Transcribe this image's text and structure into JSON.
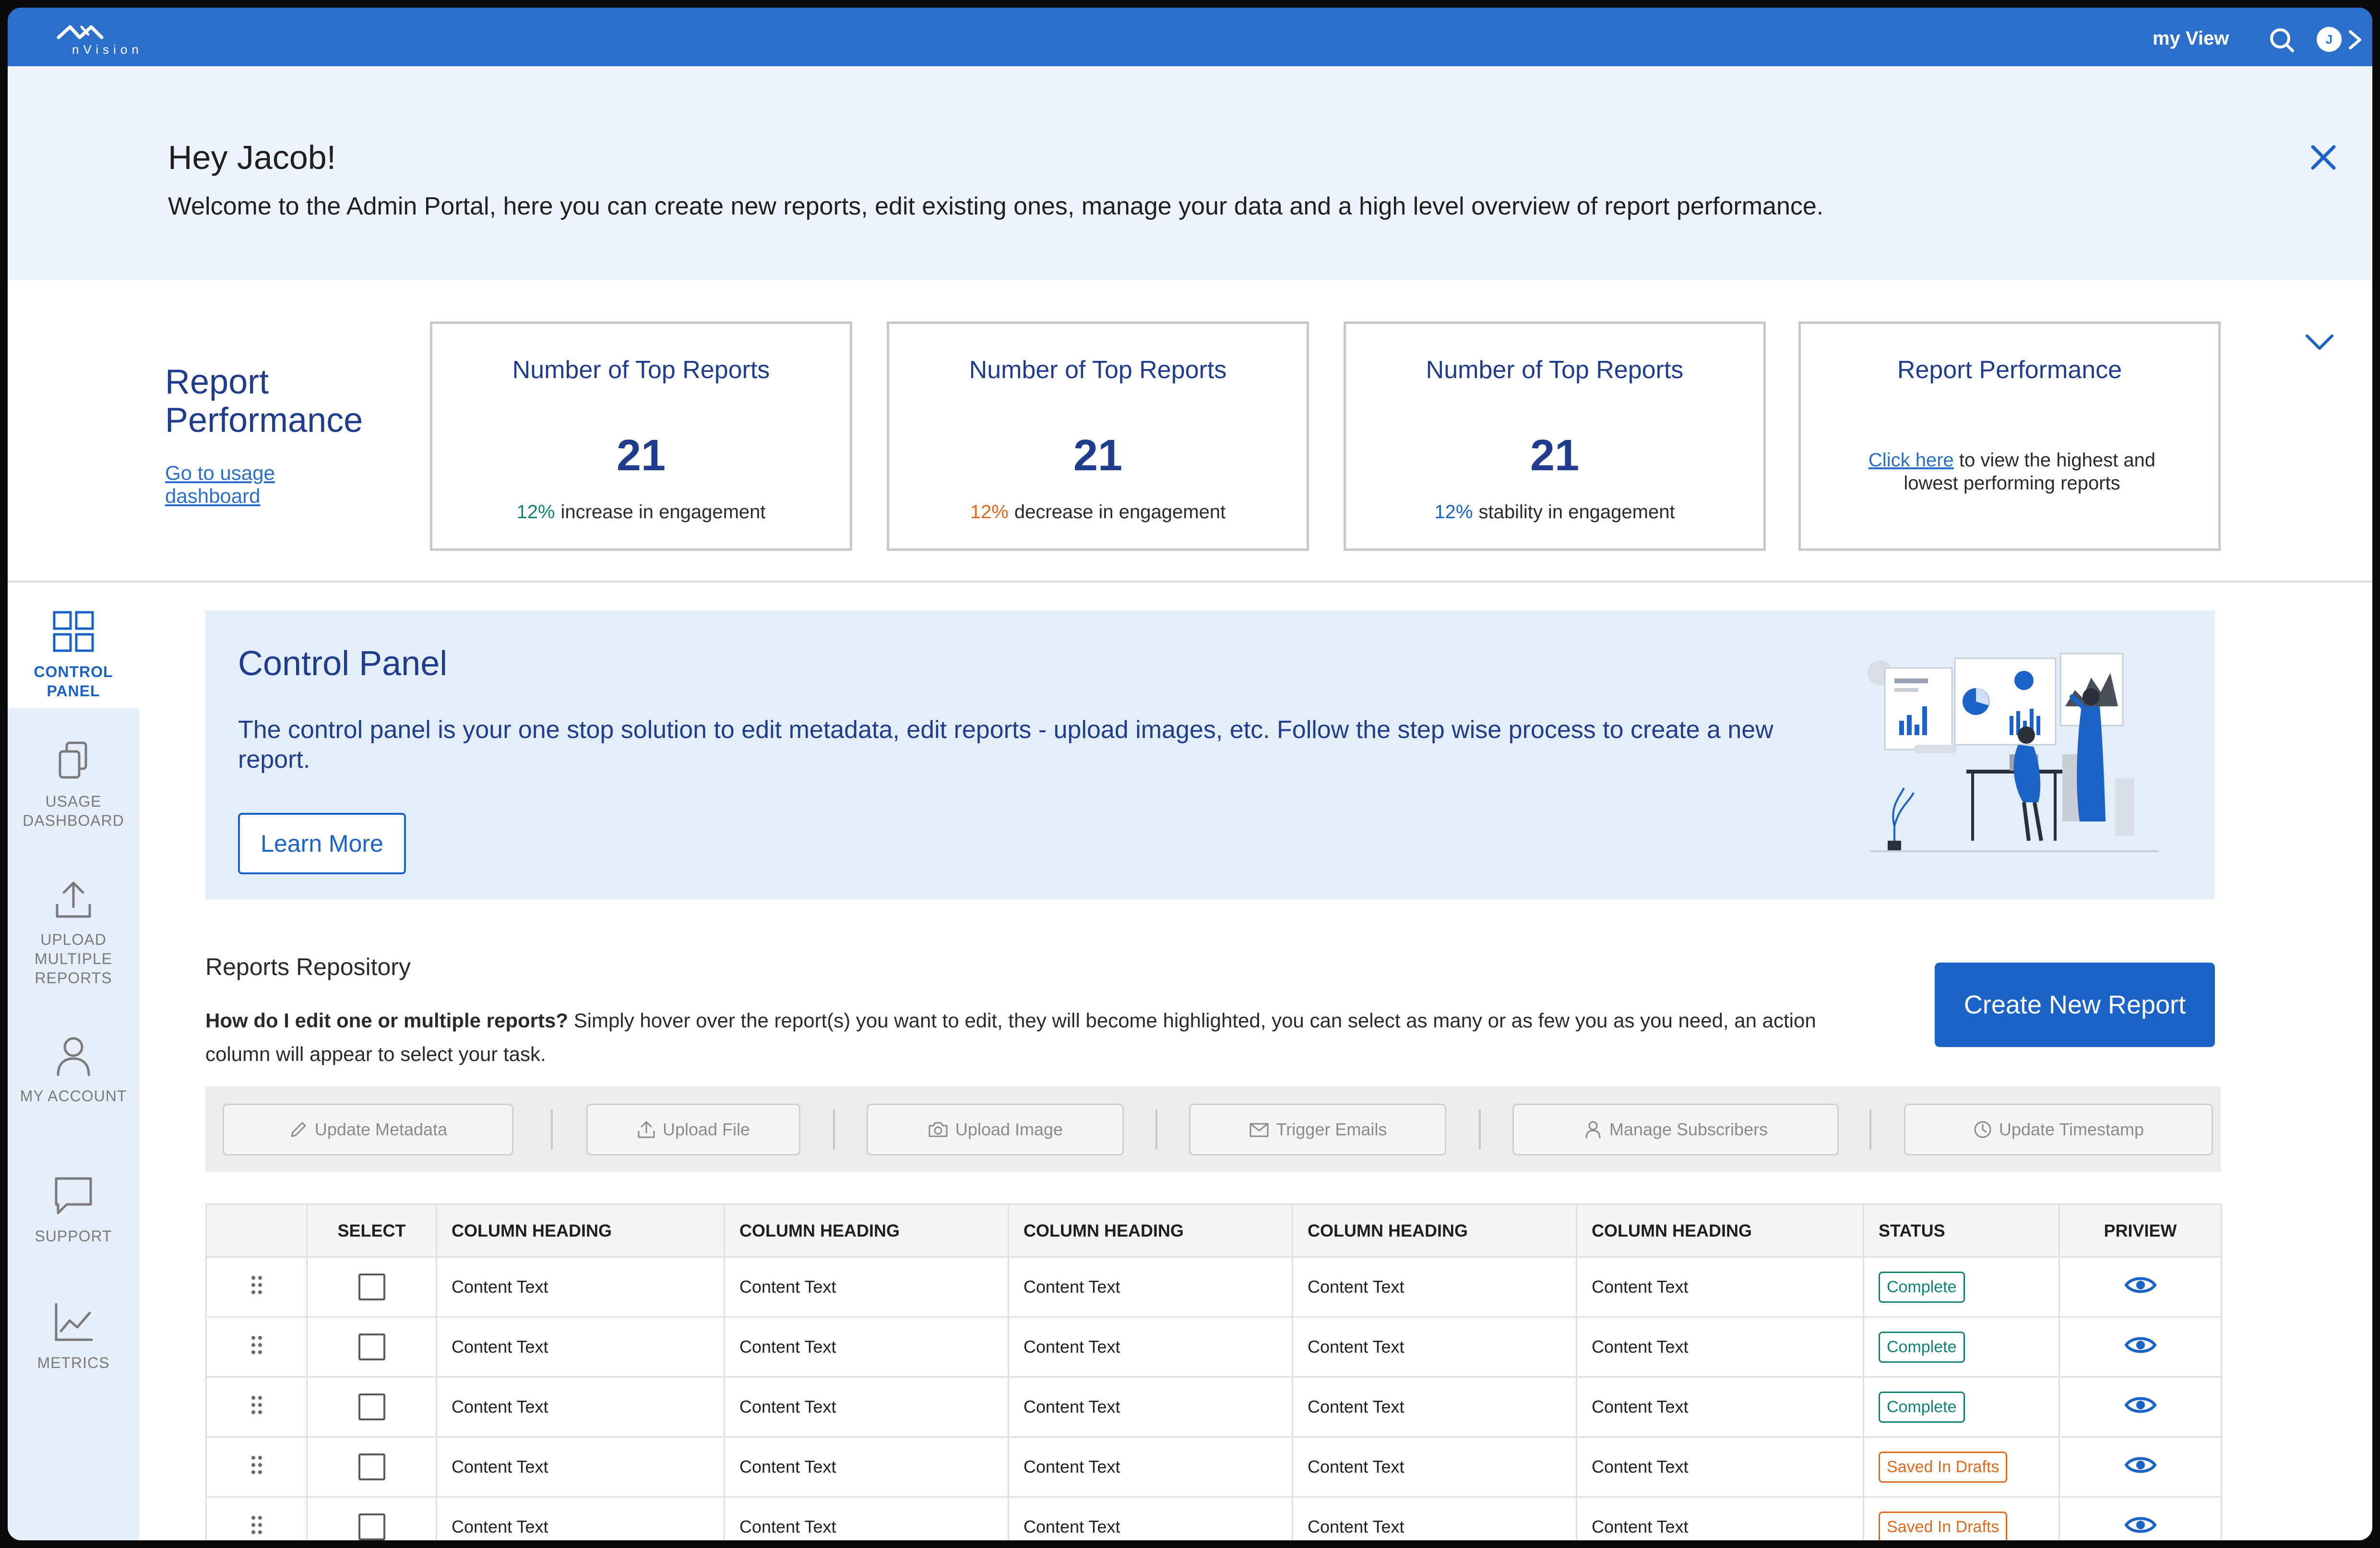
{
  "app": {
    "logo_text": "nVision",
    "my_view": "my View",
    "avatar_initial": "J"
  },
  "welcome": {
    "greeting": "Hey Jacob!",
    "message": "Welcome to the Admin Portal, here you can create new reports, edit existing ones, manage your data and a high level overview of report performance."
  },
  "performance": {
    "title": "Report Performance",
    "link": "Go to usage dashboard",
    "cards": [
      {
        "title": "Number of Top Reports",
        "value": "21",
        "pct": "12%",
        "desc": "increase in engagement",
        "color": "#128272"
      },
      {
        "title": "Number of Top Reports",
        "value": "21",
        "pct": "12%",
        "desc": "decrease in engagement",
        "color": "#e06a1c"
      },
      {
        "title": "Number of Top Reports",
        "value": "21",
        "pct": "12%",
        "desc": "stability in engagement",
        "color": "#1b63c6"
      }
    ],
    "summary_card": {
      "title": "Report Performance",
      "link": "Click here",
      "text": "to view the highest and lowest performing reports"
    }
  },
  "sidebar": {
    "items": [
      {
        "label": "CONTROL PANEL",
        "icon": "grid-icon",
        "active": true
      },
      {
        "label": "USAGE DASHBOARD",
        "icon": "copy-icon"
      },
      {
        "label": "UPLOAD MULTIPLE REPORTS",
        "icon": "upload-icon"
      },
      {
        "label": "MY ACCOUNT",
        "icon": "user-icon"
      },
      {
        "label": "SUPPORT",
        "icon": "chat-icon"
      },
      {
        "label": "METRICS",
        "icon": "chart-line-icon"
      }
    ]
  },
  "control_panel": {
    "title": "Control Panel",
    "description": "The control panel is your one stop solution to edit metadata, edit reports - upload images, etc. Follow the step wise process to create a new report.",
    "learn_more": "Learn More"
  },
  "repository": {
    "title": "Reports Repository",
    "help_bold": "How do I edit one or multiple reports?",
    "help_text": "Simply hover over the report(s) you want to edit, they will become highlighted, you can select as many or as few you as you need, an action column will appear to select your task.",
    "create_button": "Create New Report",
    "actions": [
      "Update Metadata",
      "Upload File",
      "Upload Image",
      "Trigger Emails",
      "Manage Subscribers",
      "Update Timestamp"
    ],
    "columns": [
      "",
      "SELECT",
      "COLUMN HEADING",
      "COLUMN HEADING",
      "COLUMN HEADING",
      "COLUMN HEADING",
      "COLUMN HEADING",
      "STATUS",
      "PRIVIEW"
    ],
    "rows": [
      {
        "cells": [
          "Content Text",
          "Content Text",
          "Content Text",
          "Content Text",
          "Content Text"
        ],
        "status": "Complete"
      },
      {
        "cells": [
          "Content Text",
          "Content Text",
          "Content Text",
          "Content Text",
          "Content Text"
        ],
        "status": "Complete"
      },
      {
        "cells": [
          "Content Text",
          "Content Text",
          "Content Text",
          "Content Text",
          "Content Text"
        ],
        "status": "Complete"
      },
      {
        "cells": [
          "Content Text",
          "Content Text",
          "Content Text",
          "Content Text",
          "Content Text"
        ],
        "status": "Saved In Drafts"
      },
      {
        "cells": [
          "Content Text",
          "Content Text",
          "Content Text",
          "Content Text",
          "Content Text"
        ],
        "status": "Saved In Drafts"
      }
    ]
  },
  "colors": {
    "brand": "#2c6fcb",
    "primary": "#1b63c6",
    "navy": "#1f3d8c",
    "complete": "#128272",
    "draft": "#e06a1c"
  }
}
